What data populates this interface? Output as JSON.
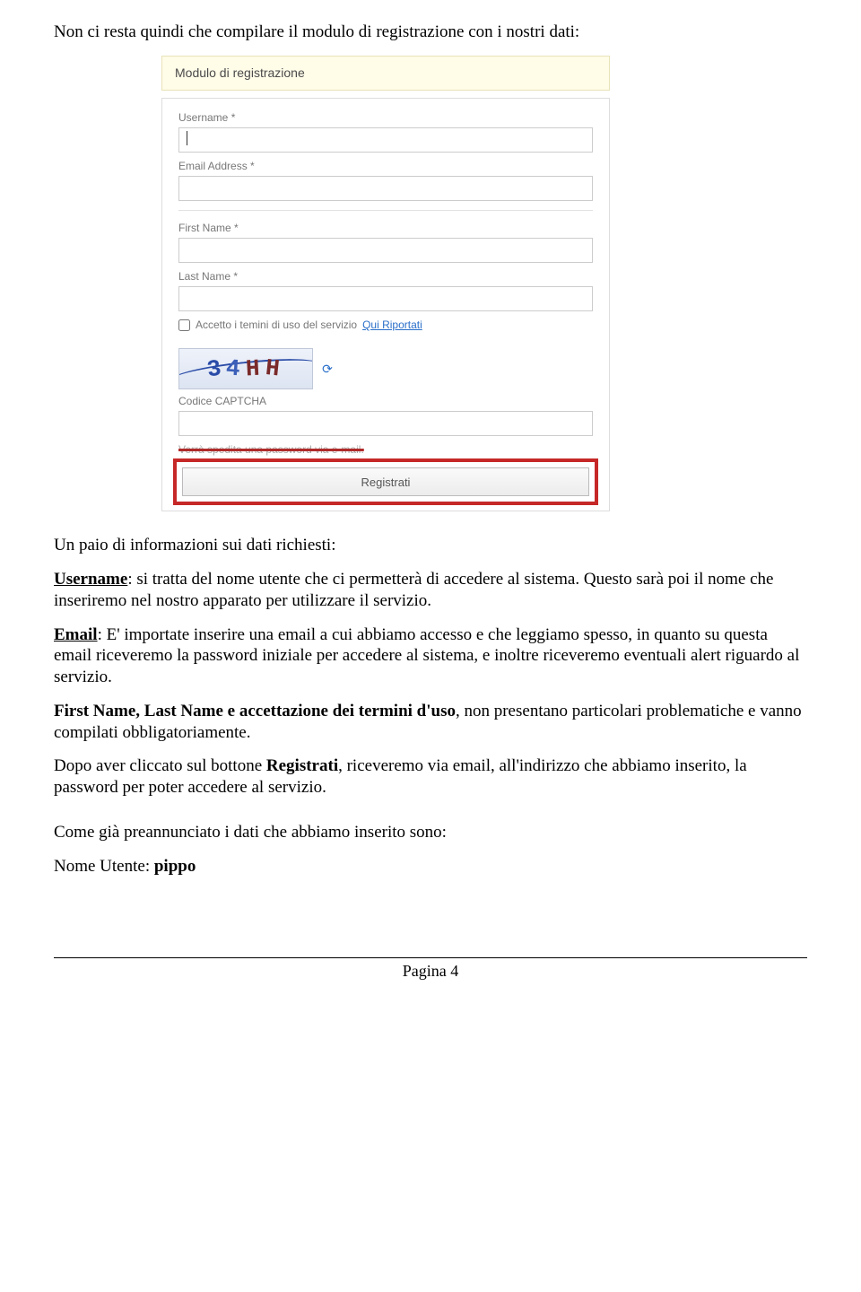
{
  "intro": "Non ci resta quindi che compilare il modulo di registrazione con i nostri dati:",
  "form": {
    "header": "Modulo di registrazione",
    "username_label": "Username *",
    "email_label": "Email Address *",
    "firstname_label": "First Name *",
    "lastname_label": "Last Name *",
    "terms_text": "Accetto i temini di uso del servizio ",
    "terms_link": "Qui Riportati",
    "captcha_value": "34HH",
    "captcha_label": "Codice CAPTCHA",
    "pwd_note": "Verrà spedita una password via e-mail.",
    "register_button": "Registrati"
  },
  "after_img": "Un paio di informazioni sui dati richiesti:",
  "username_h": "Username",
  "username_body1": ":\nsi tratta del nome utente che ci permetterà di accedere al sistema. Questo sarà poi il nome che inseriremo nel nostro apparato per utilizzare il servizio.",
  "email_h": "Email",
  "email_body": ":\nE' importate inserire una email a cui abbiamo accesso e che leggiamo spesso, in quanto su questa email riceveremo la password iniziale per accedere al sistema, e inoltre riceveremo eventuali alert riguardo al servizio.",
  "firstlast_h": "First Name, Last Name e accettazione dei termini d'uso",
  "firstlast_body": ", non presentano particolari problematiche e vanno compilati obbligatoriamente.",
  "afterclick1": "Dopo aver cliccato sul bottone ",
  "afterclick_bold": "Registrati",
  "afterclick2": ", riceveremo via email, all'indirizzo che abbiamo inserito, la password per poter accedere al servizio.",
  "preann": "Come già preannunciato i dati che abbiamo inserito sono:",
  "nomeutente_label": "Nome Utente: ",
  "nomeutente_value": "pippo",
  "page_footer": "Pagina 4"
}
